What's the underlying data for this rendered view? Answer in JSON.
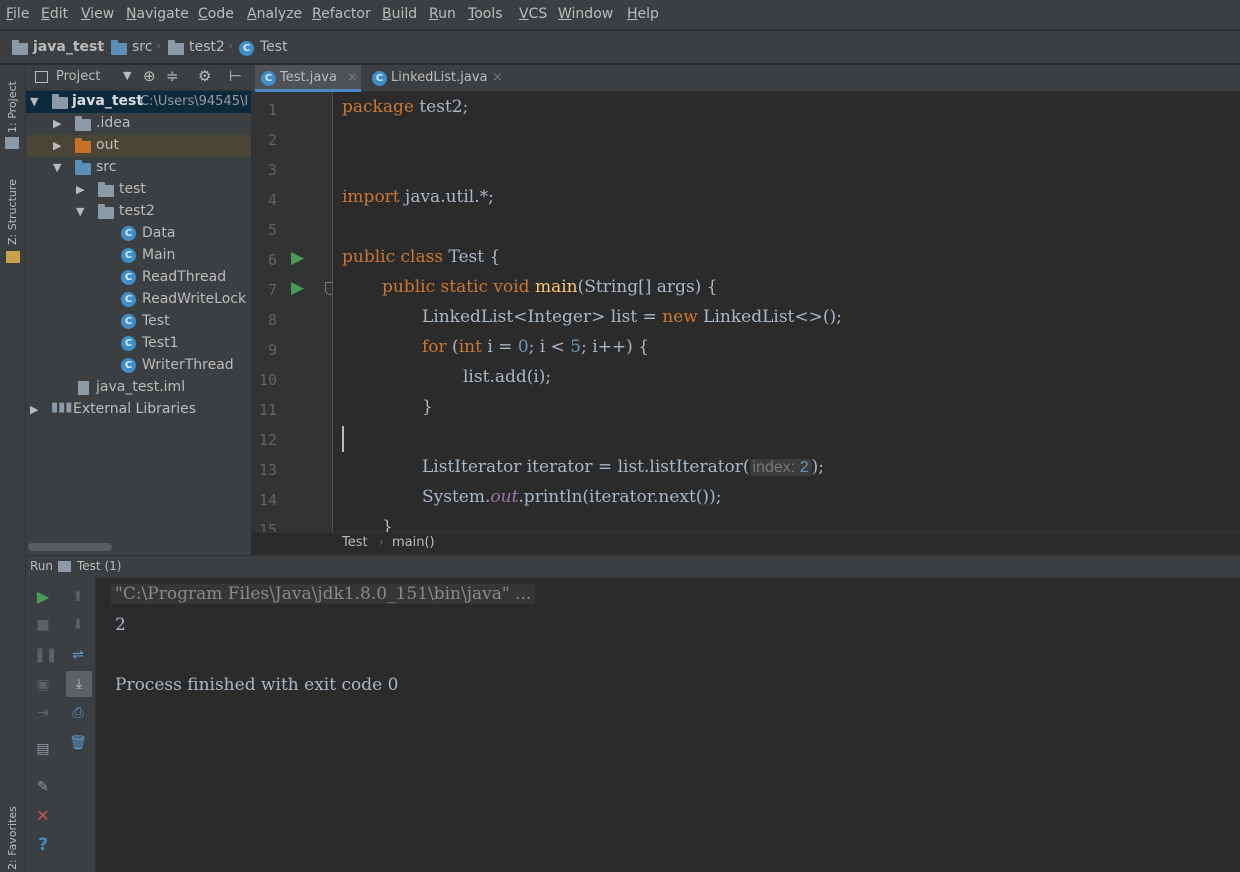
{
  "menu": [
    "File",
    "Edit",
    "View",
    "Navigate",
    "Code",
    "Analyze",
    "Refactor",
    "Build",
    "Run",
    "Tools",
    "VCS",
    "Window",
    "Help"
  ],
  "nav": {
    "project": "java_test",
    "src": "src",
    "pkg": "test2",
    "cls": "Test"
  },
  "left_tool": {
    "project": "1: Project",
    "structure": "Z: Structure",
    "favorites": "2: Favorites"
  },
  "project_panel": {
    "title": "Project",
    "root": "java_test",
    "root_path": "C:\\Users\\94545\\I",
    "idea": ".idea",
    "out": "out",
    "src": "src",
    "test": "test",
    "test2": "test2",
    "classes": [
      "Data",
      "Main",
      "ReadThread",
      "ReadWriteLock",
      "Test",
      "Test1",
      "WriterThread"
    ],
    "iml": "java_test.iml",
    "libs": "External Libraries"
  },
  "tabs": [
    {
      "label": "Test.java"
    },
    {
      "label": "LinkedList.java"
    }
  ],
  "lines": [
    "1",
    "2",
    "3",
    "4",
    "5",
    "6",
    "7",
    "8",
    "9",
    "10",
    "11",
    "12",
    "13",
    "14",
    "15"
  ],
  "code": {
    "l1_kw": "package",
    "l1_rest": " test2;",
    "l4_kw": "import",
    "l4_rest": " java.util.*;",
    "l6_kw": "public class",
    "l6_rest": " Test {",
    "l7_kw": "public static void",
    "l7_fn": "main",
    "l7_rest": "(String[] args) {",
    "l8_a": "LinkedList<Integer> list = ",
    "l8_kw": "new",
    "l8_b": " LinkedList<>();",
    "l9_kw": "for",
    "l9_a": " (",
    "l9_kw2": "int",
    "l9_b": " i = ",
    "l9_n1": "0",
    "l9_c": "; i < ",
    "l9_n2": "5",
    "l9_d": "; i++) {",
    "l10": "list.add(i);",
    "l11": "}",
    "l13_a": "ListIterator iterator = list.listIterator(",
    "l13_hint": "index:",
    "l13_n": "2",
    "l13_b": ");",
    "l14_a": "System.",
    "l14_st": "out",
    "l14_b": ".println(iterator.next());",
    "l15": "}"
  },
  "editor_crumbs": {
    "cls": "Test",
    "method": "main()"
  },
  "run": {
    "label": "Run",
    "config": "Test (1)"
  },
  "console": [
    "\"C:\\Program Files\\Java\\jdk1.8.0_151\\bin\\java\" ...",
    "2",
    "",
    "Process finished with exit code 0"
  ],
  "icons": [
    "run-icon",
    "stop-icon",
    "pause-icon",
    "up-icon",
    "down-icon",
    "soft-wrap-icon",
    "scroll-end-icon",
    "print-icon",
    "trash-icon",
    "pin-icon",
    "close-icon",
    "help-icon"
  ]
}
